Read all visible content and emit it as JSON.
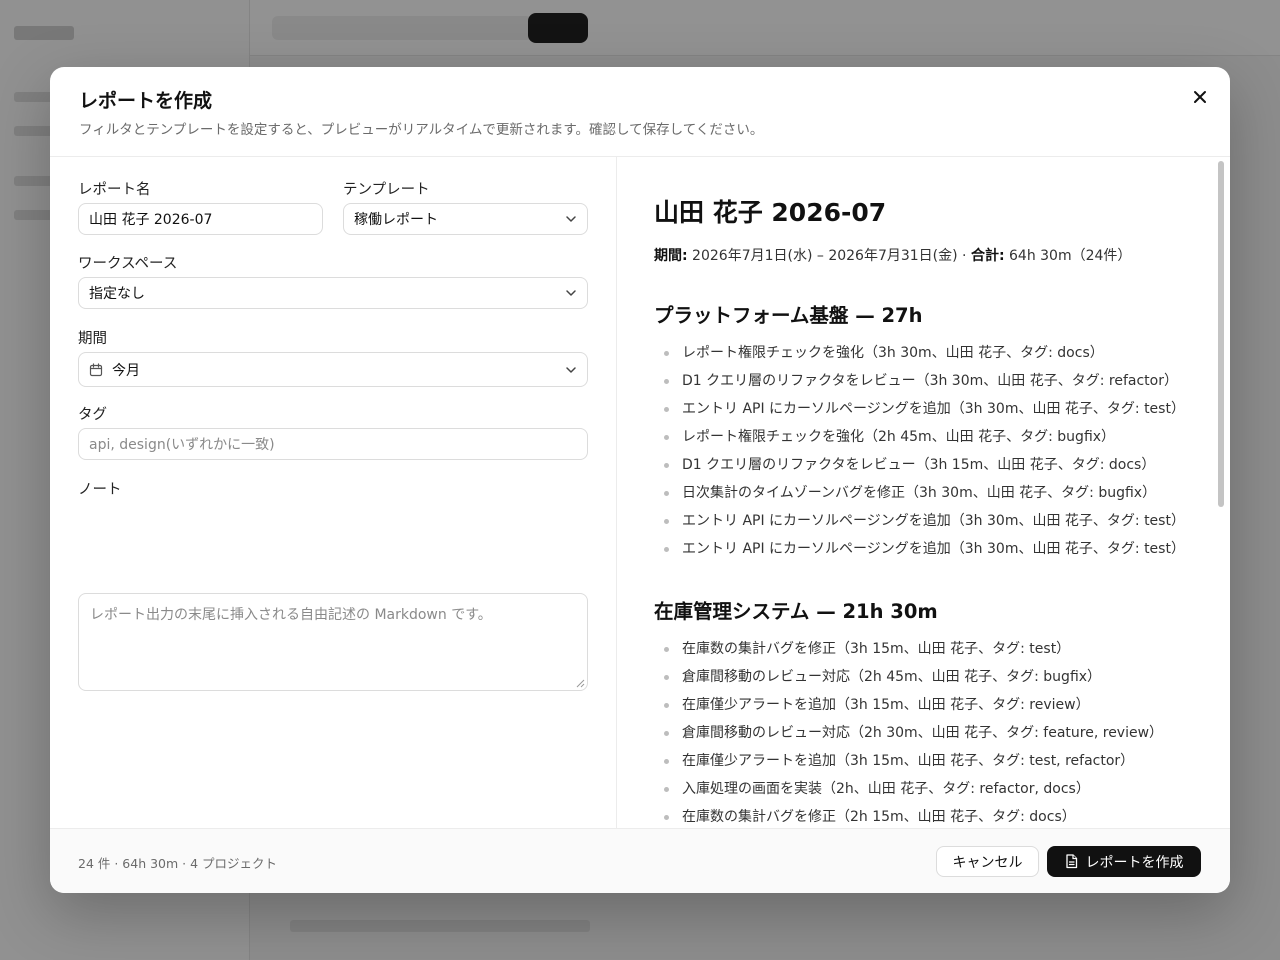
{
  "modal": {
    "title": "レポートを作成",
    "subtitle": "フィルタとテンプレートを設定すると、プレビューがリアルタイムで更新されます。確認して保存してください。"
  },
  "form": {
    "report_name_label": "レポート名",
    "report_name_value": "山田 花子 2026-07",
    "template_label": "テンプレート",
    "template_value": "稼働レポート",
    "workspace_label": "ワークスペース",
    "workspace_value": "指定なし",
    "period_label": "期間",
    "period_value": "今月",
    "tags_label": "タグ",
    "tags_placeholder": "api, design(いずれかに一致)",
    "note_label": "ノート",
    "note_placeholder": "レポート出力の末尾に挿入される自由記述の Markdown です。"
  },
  "preview": {
    "title": "山田 花子 2026-07",
    "period_key": "期間:",
    "period_value": " 2026年7月1日(水) – 2026年7月31日(金) · ",
    "total_key": "合計:",
    "total_value": " 64h 30m（24件）",
    "sections": [
      {
        "heading": "プラットフォーム基盤 — 27h",
        "items": [
          "レポート権限チェックを強化（3h 30m、山田 花子、タグ: docs）",
          "D1 クエリ層のリファクタをレビュー（3h 30m、山田 花子、タグ: refactor）",
          "エントリ API にカーソルページングを追加（3h 30m、山田 花子、タグ: test）",
          "レポート権限チェックを強化（2h 45m、山田 花子、タグ: bugfix）",
          "D1 クエリ層のリファクタをレビュー（3h 15m、山田 花子、タグ: docs）",
          "日次集計のタイムゾーンバグを修正（3h 30m、山田 花子、タグ: bugfix）",
          "エントリ API にカーソルページングを追加（3h 30m、山田 花子、タグ: test）",
          "エントリ API にカーソルページングを追加（3h 30m、山田 花子、タグ: test）"
        ]
      },
      {
        "heading": "在庫管理システム — 21h 30m",
        "items": [
          "在庫数の集計バグを修正（3h 15m、山田 花子、タグ: test）",
          "倉庫間移動のレビュー対応（2h 45m、山田 花子、タグ: bugfix）",
          "在庫僅少アラートを追加（3h 15m、山田 花子、タグ: review）",
          "倉庫間移動のレビュー対応（2h 30m、山田 花子、タグ: feature, review）",
          "在庫僅少アラートを追加（3h 15m、山田 花子、タグ: test, refactor）",
          "入庫処理の画面を実装（2h、山田 花子、タグ: refactor, docs）",
          "在庫数の集計バグを修正（2h 15m、山田 花子、タグ: docs）"
        ]
      }
    ]
  },
  "footer": {
    "summary": "24 件 · 64h 30m · 4 プロジェクト",
    "cancel_label": "キャンセル",
    "create_label": "レポートを作成"
  },
  "icons": {
    "close": "close-icon",
    "chevron": "chevron-down-icon",
    "calendar": "calendar-icon",
    "document": "document-icon"
  }
}
